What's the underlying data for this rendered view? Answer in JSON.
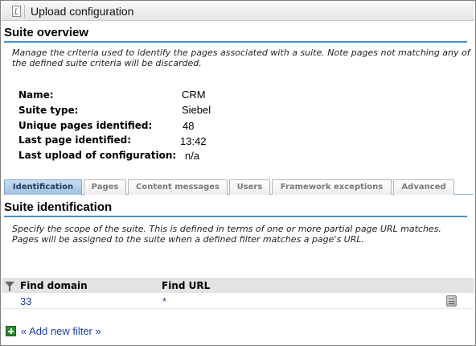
{
  "toolbar": {
    "title": "Upload configuration"
  },
  "overview": {
    "heading": "Suite overview",
    "description": "Manage the criteria used to identify the pages associated with a suite. Note pages not matching any of the defined suite criteria will be discarded.",
    "fields": [
      {
        "label": "Name:",
        "value": "CRM"
      },
      {
        "label": "Suite type:",
        "value": "Siebel"
      },
      {
        "label": "Unique pages identified:",
        "value": "48"
      },
      {
        "label": "Last page identified:",
        "value": "13:42"
      },
      {
        "label": "Last upload of configuration:",
        "value": "n/a"
      }
    ]
  },
  "tabs": [
    {
      "label": "Identification",
      "active": true
    },
    {
      "label": "Pages"
    },
    {
      "label": "Content messages"
    },
    {
      "label": "Users"
    },
    {
      "label": "Framework exceptions"
    },
    {
      "label": "Advanced"
    }
  ],
  "identification": {
    "heading": "Suite identification",
    "description": "Specify the scope of the suite. This is defined in terms of one or more partial page URL matches. Pages will be assigned to the suite when a defined filter matches a page's URL.",
    "columns": {
      "domain": "Find domain",
      "url": "Find URL"
    },
    "rows": [
      {
        "domain": "33",
        "url": "*"
      }
    ],
    "add_filter": "« Add new filter »"
  },
  "colors": {
    "accent_rule": "#4a90c8",
    "link": "#1a3fa8",
    "active_tab": "#9ec0e2"
  },
  "icons": [
    "upload-config-icon",
    "filter-funnel-icon",
    "delete-filter-icon",
    "add-filter-icon"
  ]
}
